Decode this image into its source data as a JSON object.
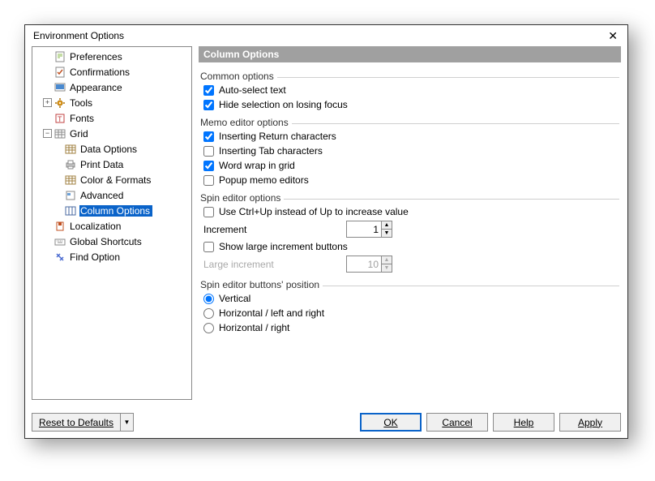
{
  "title": "Environment Options",
  "tree": {
    "preferences": "Preferences",
    "confirmations": "Confirmations",
    "appearance": "Appearance",
    "tools": "Tools",
    "fonts": "Fonts",
    "grid": "Grid",
    "data_options": "Data Options",
    "print_data": "Print Data",
    "color_formats": "Color & Formats",
    "advanced": "Advanced",
    "column_options": "Column Options",
    "localization": "Localization",
    "global_shortcuts": "Global Shortcuts",
    "find_option": "Find Option"
  },
  "panel": {
    "header": "Column Options",
    "common": {
      "legend": "Common options",
      "auto_select": "Auto-select text",
      "hide_selection": "Hide selection on losing focus"
    },
    "memo": {
      "legend": "Memo editor options",
      "insert_return": "Inserting Return characters",
      "insert_tab": "Inserting Tab characters",
      "word_wrap": "Word wrap in grid",
      "popup": "Popup memo editors"
    },
    "spin": {
      "legend": "Spin editor options",
      "ctrl_up": "Use Ctrl+Up instead of Up to increase value",
      "increment_label": "Increment",
      "increment_value": "1",
      "show_large": "Show large increment buttons",
      "large_label": "Large increment",
      "large_value": "10"
    },
    "position": {
      "legend": "Spin editor buttons' position",
      "vertical": "Vertical",
      "horiz_lr": "Horizontal / left and right",
      "horiz_r": "Horizontal / right"
    }
  },
  "footer": {
    "reset": "Reset to Defaults",
    "ok": "OK",
    "cancel": "Cancel",
    "help": "Help",
    "apply": "Apply"
  }
}
